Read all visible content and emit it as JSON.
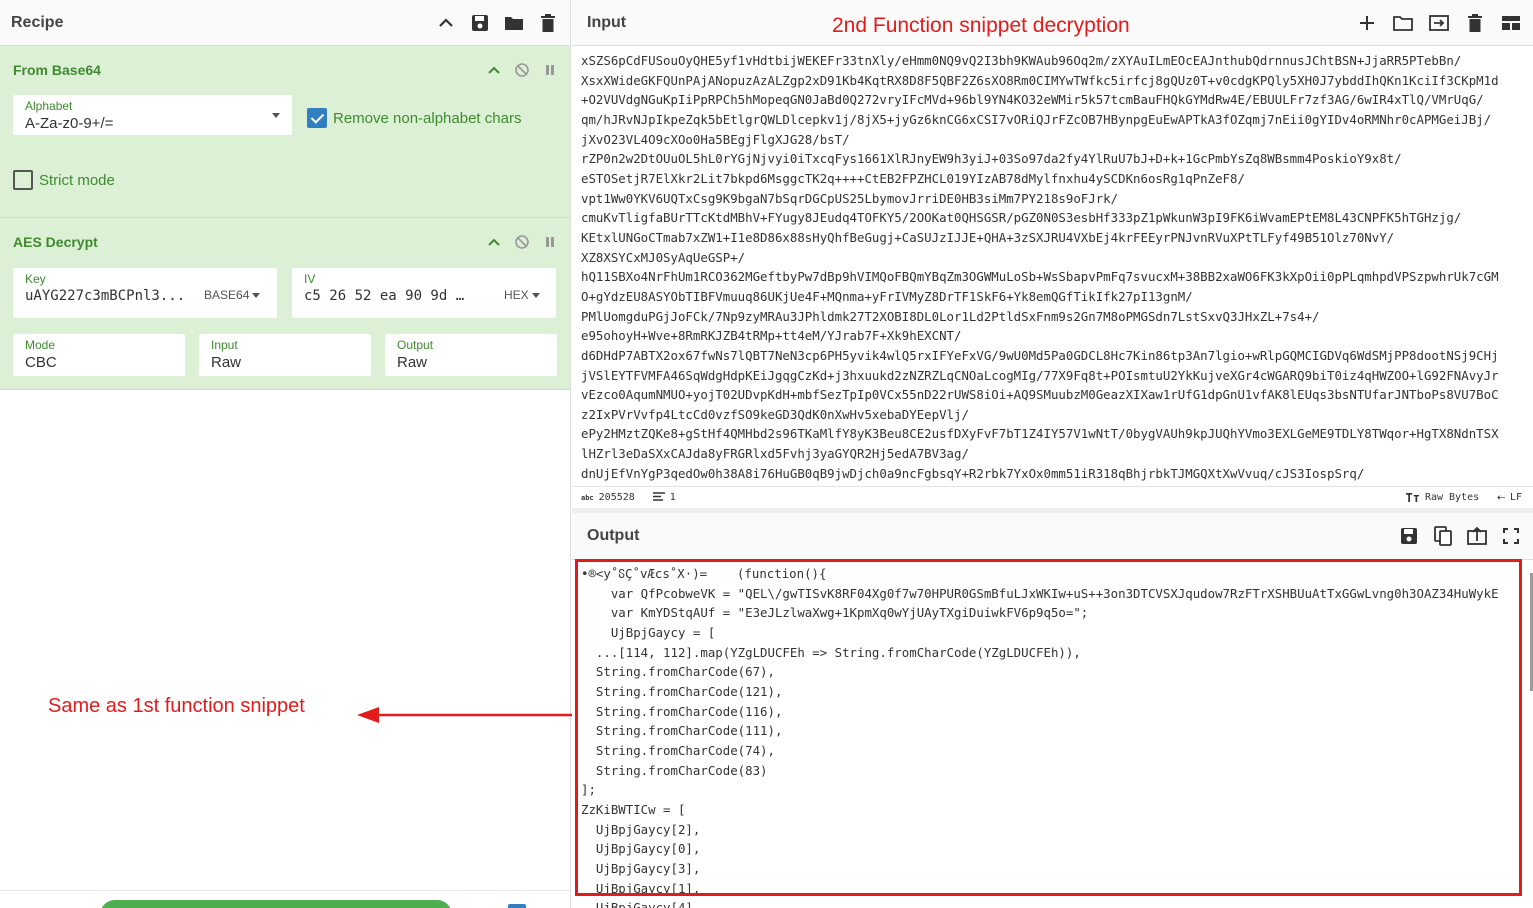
{
  "recipe": {
    "title": "Recipe",
    "operations": {
      "from_base64": {
        "name": "From Base64",
        "alphabet_label": "Alphabet",
        "alphabet_value": "A-Za-z0-9+/=",
        "remove_non_alpha_label": "Remove non-alphabet chars",
        "strict_mode_label": "Strict mode"
      },
      "aes_decrypt": {
        "name": "AES Decrypt",
        "key_label": "Key",
        "key_value": "uAYG227c3mBCPnl3...",
        "key_format": "BASE64",
        "iv_label": "IV",
        "iv_value": "c5 26 52 ea 90 9d  …",
        "iv_format": "HEX",
        "mode_label": "Mode",
        "mode_value": "CBC",
        "input_label": "Input",
        "input_value": "Raw",
        "output_label": "Output",
        "output_value": "Raw"
      }
    },
    "annotation": "Same as 1st function snippet"
  },
  "input": {
    "title": "Input",
    "annotation": "2nd Function snippet decryption",
    "lines": [
      "xSZS6pCdFUSouOyQHE5yf1vHdtbijWEKEFr33tnXly/eHmm0NQ9vQ2I3bh9KWAub96Oq2m/zXYAuILmEOcEAJnthubQdrnnusJChtBSN+JjaRR5PTebBn/",
      "XsxXWideGKFQUnPAjANopuzAzALZgp2xD91Kb4KqtRX8D8F5QBF2Z6sXO8Rm0CIMYwTWfkc5irfcj8gQUz0T+v0cdgKPQly5XH0J7ybddIhQKn1KciIf3CKpM1d",
      "+O2VUVdgNGuKpIiPpRPCh5hMopeqGN0JaBd0Q272vryIFcMVd+96bl9YN4KO32eWMir5k57tcmBauFHQkGYMdRw4E/EBUULFr7zf3AG/6wIR4xTlQ/VMrUqG/",
      "qm/hJRvNJpIkpeZqk5bEtlgrQWLDlcepkv1j/8jX5+jyGz6knCG6xCSI7vORiQJrFZcOB7HBynpgEuEwAPTkA3fOZqmj7nEii0gYIDv4oRMNhr0cAPMGeiJBj/",
      "jXvO23VL4O9cXOo0Ha5BEgjFlgXJG28/bsT/",
      "rZP0n2w2DtOUuOL5hL0rYGjNjvyi0iTxcqFys1661XlRJnyEW9h3yiJ+03So97da2fy4YlRuU7bJ+D+k+1GcPmbYsZq8WBsmm4PoskioY9x8t/",
      "eSTOSetjR7ElXkr2Lit7bkpd6MsggcTK2q++++CtEB2FPZHCL019YIzAB78dMylfnxhu4ySCDKn6osRg1qPnZeF8/",
      "vpt1Ww0YKV6UQTxCsg9K9bgaN7bSqrDGCpUS25LbymovJrriDE0HB3siMm7PY218s9oFJrk/",
      "cmuKvTligfaBUrTTcKtdMBhV+FYugy8JEudq4TOFKY5/2OOKat0QHSGSR/pGZ0N0S3esbHf333pZ1pWkunW3pI9FK6iWvamEPtEM8L43CNPFK5hTGHzjg/",
      "KEtxlUNGoCTmab7xZW1+I1e8D86x88sHyQhfBeGugj+CaSUJzIJJE+QHA+3zSXJRU4VXbEj4krFEEyrPNJvnRVuXPtTLFyf49B51Olz70NvY/",
      "XZ8XSYCxMJ0SyAqUeGSP+/",
      "hQ11SBXo4NrFhUm1RCO362MGeftbyPw7dBp9hVIMQoFBQmYBqZm3OGWMuLoSb+WsSbapvPmFq7svucxM+38BB2xaWO6FK3kXpOii0pPLqmhpdVPSzpwhrUk7cGM",
      "O+gYdzEU8ASYObTIBFVmuuq86UKjUe4F+MQnma+yFrIVMyZ8DrTF1SkF6+Yk8emQGfTikIfk27pI13gnM/",
      "PMlUomgduPGjJoFCk/7Np9zyMRAu3JPhldmk27T2XOBI8DL0Lor1Ld2PtldSxFnm9s2Gn7M8oPMGSdn7LstSxvQ3JHxZL+7s4+/",
      "e95ohoyH+Wve+8RmRKJZB4tRMp+tt4eM/YJrab7F+Xk9hEXCNT/",
      "d6DHdP7ABTX2ox67fwNs7lQBT7NeN3cp6PH5yvik4wlQ5rxIFYeFxVG/9wU0Md5Pa0GDCL8Hc7Kin86tp3An7lgio+wRlpGQMCIGDVq6WdSMjPP8dootNSj9CHj",
      "jVSlEYTFVMFA46SqWdgHdpKEiJgqgCzKd+j3hxuukd2zNZRZLqCNOaLcogMIg/77X9Fq8t+POIsmtuU2YkKujveXGr4cWGARQ9biT0iz4qHWZOO+lG92FNAvyJr",
      "vEzco0AqumNMUO+yojT02UDvpKdH+mbfSezTpIp0VCx55nD22rUWS8iOi+AQ9SMuubzM0GeazXIXaw1rUfG1dpGnU1vfAK8lEUqs3bsNTUfarJNTboPs8VU7BoC",
      "z2IxPVrVvfp4LtcCd0vzfSO9keGD3QdK0nXwHv5xebaDYEepVlj/",
      "ePy2HMztZQKe8+gStHf4QMHbd2s96TKaMlfY8yK3Beu8CE2usfDXyFvF7bT1Z4IY57V1wNtT/0bygVAUh9kpJUQhYVmo3EXLGeME9TDLY8TWqor+HgTX8NdnTSX",
      "lHZrl3eDaSXxCAJda8yFRGRlxd5Fvhj3yaGYQR2Hj5edA7BV3ag/",
      "dnUjEfVnYgP3qedOw0h38A8i76HuGB0qB9jwDjch0a9ncFgbsqY+R2rbk7YxOx0mm51iR318qBhjrbkTJMGQXtXwVvuq/cJS3IospSrq/"
    ],
    "status": {
      "length": "205528",
      "lines": "1",
      "encoding": "Raw Bytes",
      "eol": "LF"
    }
  },
  "output": {
    "title": "Output",
    "lines": [
      "•®<y˚ჽÇ˚vÆcs˚X·)=    (function(){",
      "    var QfPcobweVK = \"QEL\\/gwTISvK8RF04Xg0f7w70HPUR0GSmBfuLJxWKIw+uS++3on3DTCVSXJqudow7RzFTrXSHBUuAtTxGGwLvng0h3OAZ34HuWykE",
      "    var KmYDStqAUf = \"E3eJLzlwaXwg+1KpmXq0wYjUAyTXgiDuiwkFV6p9q5o=\";",
      "    UjBpjGaycy = [",
      "  ...[114, 112].map(YZgLDUCFEh => String.fromCharCode(YZgLDUCFEh)),",
      "  String.fromCharCode(67),",
      "  String.fromCharCode(121),",
      "  String.fromCharCode(116),",
      "  String.fromCharCode(111),",
      "  String.fromCharCode(74),",
      "  String.fromCharCode(83)",
      "];",
      "ZzKiBWTICw = [",
      "  UjBpjGaycy[2],",
      "  UjBpjGaycy[0],",
      "  UjBpjGaycy[3],",
      "  UjBpjGaycy[1],",
      "  UjBpjGaycy[4]"
    ]
  },
  "colors": {
    "accent_green": "#3f8a2f",
    "op_background": "#dcf0d5",
    "annotation_red": "#e31b1b",
    "checkbox_blue": "#2f7fc1"
  }
}
